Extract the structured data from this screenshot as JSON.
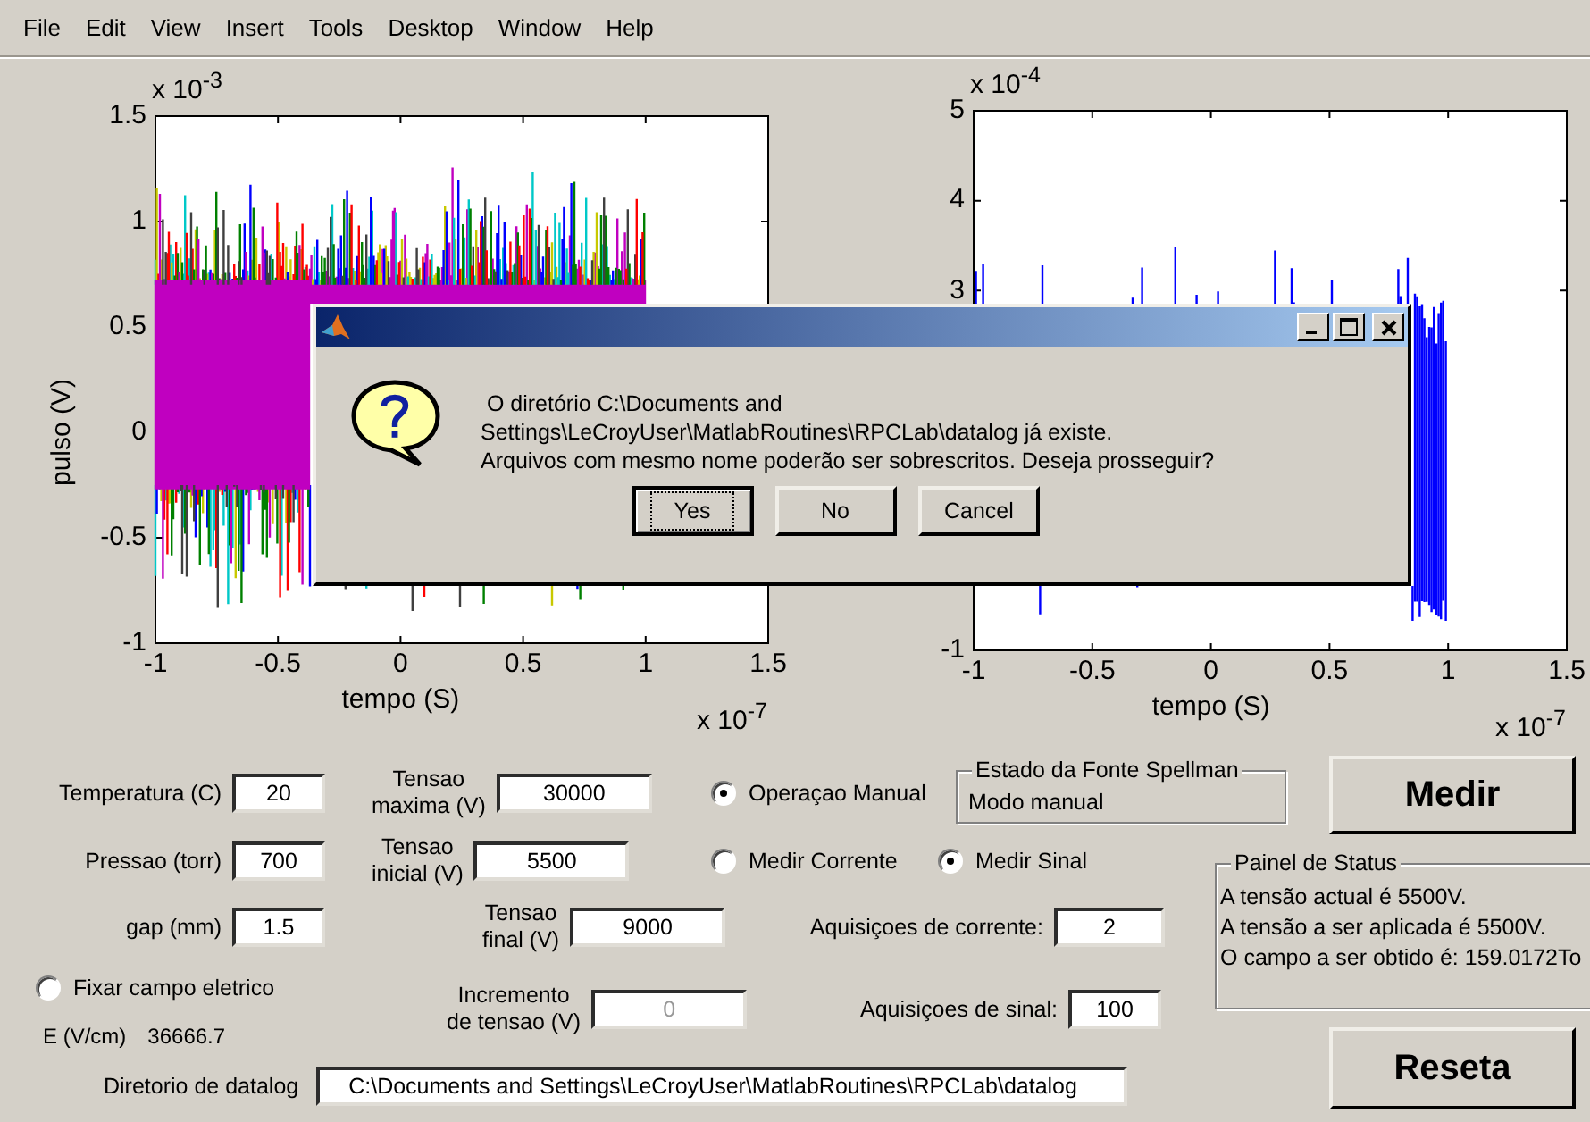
{
  "menu": [
    "File",
    "Edit",
    "View",
    "Insert",
    "Tools",
    "Desktop",
    "Window",
    "Help"
  ],
  "plots": [
    {
      "kind": "multicolor",
      "y_exponent": "x 10$^{-3}$",
      "x_exponent": "x 10$^{-7}$",
      "ylabel": "pulso (V)",
      "xlabel": "tempo (S)",
      "yticks": [
        "1.5",
        "1",
        "0.5",
        "0",
        "-0.5",
        "-1"
      ],
      "xticks": [
        "-1",
        "-0.5",
        "0",
        "0.5",
        "1",
        "1.5"
      ]
    },
    {
      "kind": "single",
      "y_exponent": "x 10$^{-4}$",
      "x_exponent": "x 10$^{-7}$",
      "xlabel": "tempo (S)",
      "yticks": [
        "5",
        "4",
        "3",
        "-1"
      ],
      "xticks": [
        "-1",
        "-0.5",
        "0",
        "0.5",
        "1",
        "1.5"
      ]
    }
  ],
  "fields": {
    "temperatura": {
      "label": "Temperatura (C)",
      "value": "20",
      "disabled": false
    },
    "pressao": {
      "label": "Pressao (torr)",
      "value": "700",
      "disabled": false
    },
    "gap": {
      "label": "gap (mm)",
      "value": "1.5",
      "disabled": false
    },
    "tensao_maxima": {
      "label_lines": [
        "Tensao",
        "maxima (V)"
      ],
      "value": "30000",
      "disabled": false
    },
    "tensao_inicial": {
      "label_lines": [
        "Tensao",
        "inicial (V)"
      ],
      "value": "5500",
      "disabled": false
    },
    "tensao_final": {
      "label_lines": [
        "Tensao",
        "final (V)"
      ],
      "value": "9000",
      "disabled": false
    },
    "incremento": {
      "label_lines": [
        "Incremento",
        "de tensao (V)"
      ],
      "value": "0",
      "disabled": true
    },
    "aquisicoes_corrente": {
      "label": "Aquisiçoes de corrente:",
      "value": "2",
      "disabled": false
    },
    "aquisicoes_sinal": {
      "label": "Aquisiçoes de sinal:",
      "value": "100",
      "disabled": false
    },
    "diretorio": {
      "label": "Diretorio de datalog",
      "value": "C:\\Documents and Settings\\LeCroyUser\\MatlabRoutines\\RPCLab\\datalog",
      "disabled": false
    }
  },
  "fixar_campo": {
    "label": "Fixar campo eletrico",
    "selected": false
  },
  "campo": {
    "label": "E (V/cm)",
    "value": "36666.7"
  },
  "modo": {
    "label": "Operaçao Manual",
    "selected": true
  },
  "medicao": [
    {
      "label": "Medir Corrente",
      "selected": false
    },
    {
      "label": "Medir Sinal",
      "selected": true
    }
  ],
  "estado_fonte": {
    "title": "Estado da Fonte Spellman",
    "text": "Modo manual"
  },
  "painel_status": {
    "title": "Painel de Status",
    "lines": [
      "A tensão actual é 5500V.",
      "A tensão a ser aplicada é 5500V.",
      "O campo a ser obtido é: 159.0172To"
    ]
  },
  "buttons": {
    "medir": "Medir",
    "reseta": "Reseta"
  },
  "dialog": {
    "message_lines": [
      " O diretório C:\\Documents and",
      "Settings\\LeCroyUser\\MatlabRoutines\\RPCLab\\datalog já existe.",
      "Arquivos com mesmo nome poderão ser sobrescritos. Deseja prosseguir?"
    ],
    "buttons": [
      {
        "label": "Yes",
        "focused": true
      },
      {
        "label": "No",
        "focused": false
      },
      {
        "label": "Cancel",
        "focused": false
      }
    ]
  }
}
